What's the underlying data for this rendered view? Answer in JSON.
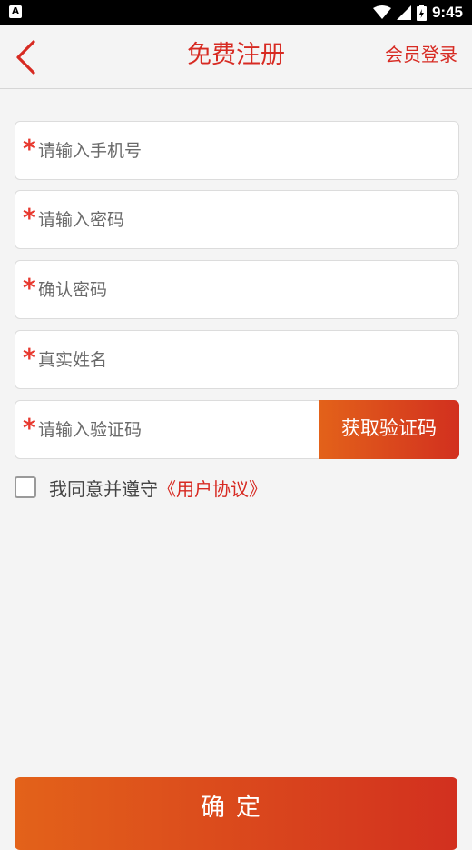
{
  "status_bar": {
    "time": "9:45",
    "app_icon_letter": "A"
  },
  "header": {
    "title": "免费注册",
    "login_link": "会员登录"
  },
  "form": {
    "required_mark": "*",
    "phone_placeholder": "请输入手机号",
    "password_placeholder": "请输入密码",
    "confirm_password_placeholder": "确认密码",
    "real_name_placeholder": "真实姓名",
    "code_placeholder": "请输入验证码",
    "get_code_label": "获取验证码"
  },
  "agreement": {
    "text": "我同意并遵守",
    "link": "《用户协议》",
    "checked": false
  },
  "submit": {
    "label": "确定"
  },
  "colors": {
    "accent": "#d72a22",
    "gradient_start": "#e3621a",
    "gradient_end": "#d2301f",
    "background": "#f4f4f4"
  }
}
